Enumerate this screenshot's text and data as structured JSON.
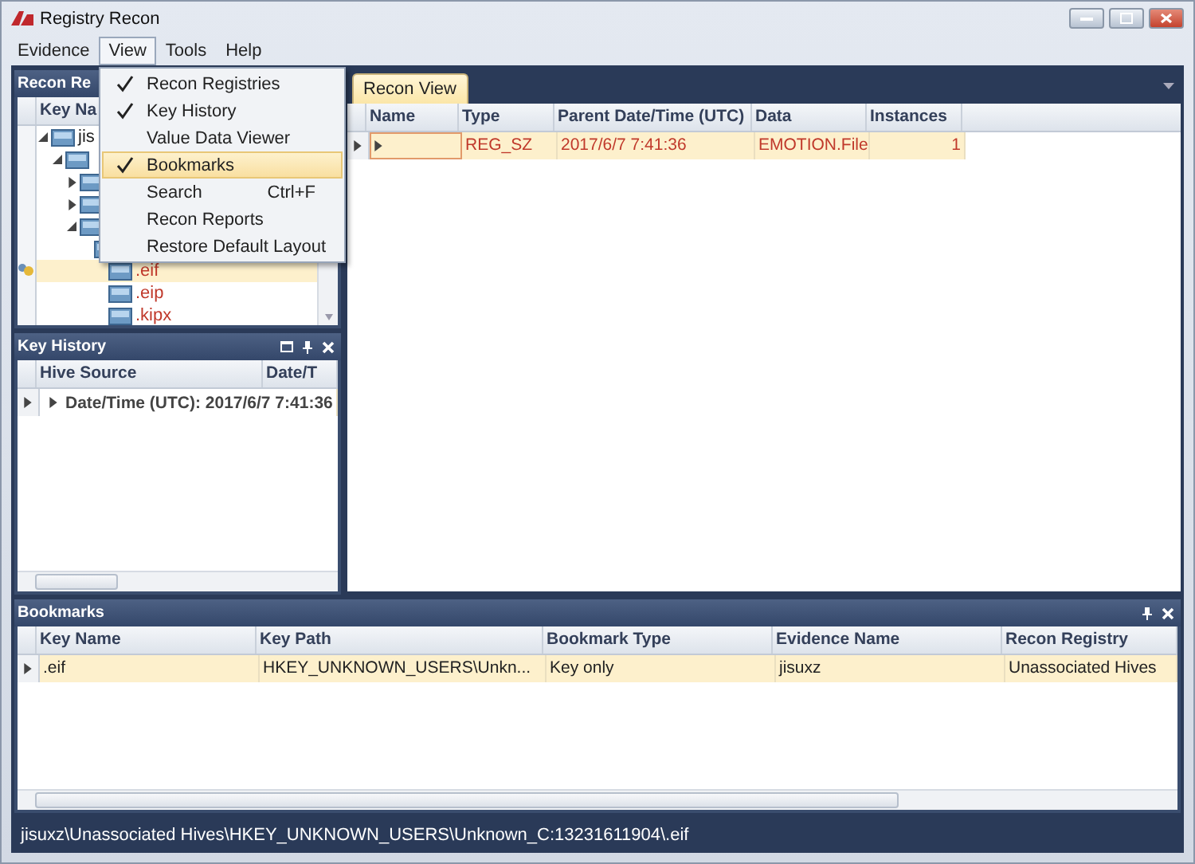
{
  "window": {
    "title": "Registry Recon"
  },
  "menu_bar": [
    {
      "label": "Evidence",
      "selected": false
    },
    {
      "label": "View",
      "selected": true
    },
    {
      "label": "Tools",
      "selected": false
    },
    {
      "label": "Help",
      "selected": false
    }
  ],
  "view_menu": [
    {
      "label": "Recon Registries",
      "checked": true,
      "selected": false
    },
    {
      "label": "Key History",
      "checked": true,
      "selected": false
    },
    {
      "label": "Value Data Viewer",
      "checked": false,
      "selected": false
    },
    {
      "label": "Bookmarks",
      "checked": true,
      "selected": true
    },
    {
      "label": "Search",
      "shortcut": "Ctrl+F",
      "checked": false,
      "selected": false
    },
    {
      "label": "Recon Reports",
      "checked": false,
      "selected": false
    },
    {
      "label": "Restore Default Layout",
      "checked": false,
      "selected": false
    }
  ],
  "recon_registries": {
    "title": "Recon Re",
    "column": "Key Na",
    "tree": [
      {
        "label": "jis",
        "expanded": true,
        "selected": false,
        "children": [
          {
            "expanded": true,
            "selected": false,
            "children": [
              {
                "expanded": false,
                "selected": false
              },
              {
                "expanded": false,
                "selected": false
              },
              {
                "expanded": true,
                "selected": false,
                "children": [
                  {
                    "selected": false,
                    "children": [
                      {
                        "label": ".eif",
                        "selected": true,
                        "bookmarked": true
                      },
                      {
                        "label": ".eip",
                        "selected": false,
                        "bookmarked": false
                      },
                      {
                        "label": ".kipx",
                        "selected": false,
                        "bookmarked": false
                      }
                    ]
                  }
                ]
              }
            ]
          }
        ]
      }
    ]
  },
  "key_history": {
    "title": "Key History",
    "columns": [
      "Hive Source",
      "Date/T"
    ],
    "rows": [
      {
        "text": "Date/Time (UTC): 2017/6/7 7:41:36",
        "expanded": false
      }
    ]
  },
  "recon_view": {
    "tabs": [
      {
        "label": "Recon View",
        "selected": true
      }
    ],
    "columns": [
      "Name",
      "Type",
      "Parent Date/Time (UTC)",
      "Data",
      "Instances"
    ],
    "rows": [
      {
        "cells": [
          "",
          "REG_SZ",
          "2017/6/7 7:41:36",
          "EMOTION.File",
          "1"
        ],
        "selected": true
      }
    ]
  },
  "bookmarks": {
    "title": "Bookmarks",
    "columns": [
      "Key Name",
      "Key Path",
      "Bookmark Type",
      "Evidence Name",
      "Recon Registry"
    ],
    "rows": [
      {
        "cells": [
          ".eif",
          "HKEY_UNKNOWN_USERS\\Unkn...",
          "Key only",
          "jisuxz",
          "Unassociated Hives"
        ],
        "selected": true
      }
    ]
  },
  "status_bar": "jisuxz\\Unassociated Hives\\HKEY_UNKNOWN_USERS\\Unknown_C:13231611904\\.eif"
}
